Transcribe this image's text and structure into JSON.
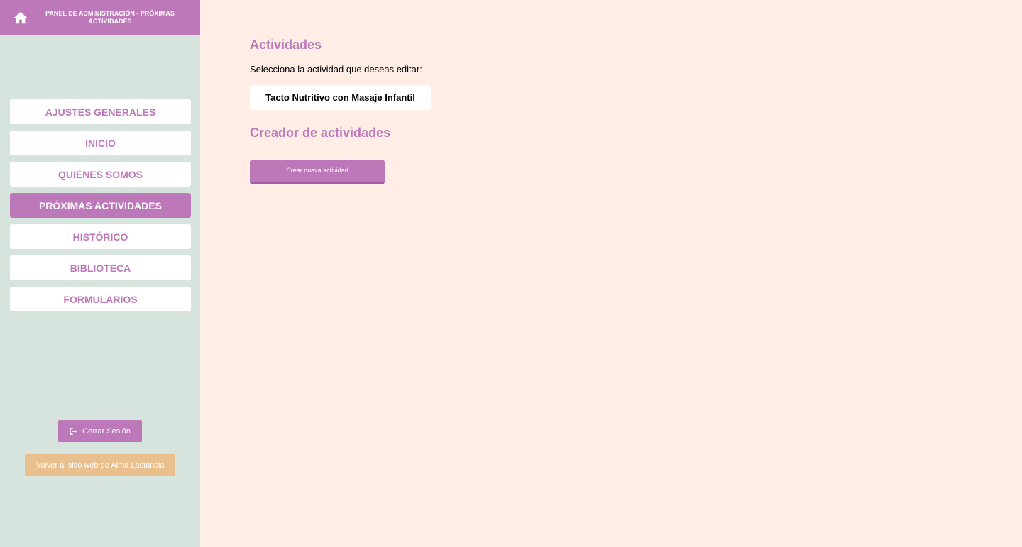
{
  "header": {
    "title": "PANEL DE ADMINISTRACIÓN - PRÓXIMAS ACTIVIDADES",
    "home_icon": "home-icon"
  },
  "sidebar": {
    "items": [
      {
        "label": "AJUSTES GENERALES",
        "active": false
      },
      {
        "label": "INICIO",
        "active": false
      },
      {
        "label": "QUIÉNES SOMOS",
        "active": false
      },
      {
        "label": "PRÓXIMAS ACTIVIDADES",
        "active": true
      },
      {
        "label": "HISTÓRICO",
        "active": false
      },
      {
        "label": "BIBLIOTECA",
        "active": false
      },
      {
        "label": "FORMULARIOS",
        "active": false
      }
    ],
    "logout_label": "Cerrar Sesión",
    "logout_icon": "sign-out-icon",
    "back_label": "Volver al sitio web de Alma Lactancia"
  },
  "main": {
    "activities_title": "Actividades",
    "select_prompt": "Selecciona la actividad que deseas editar:",
    "activities": [
      "Tacto Nutritivo con Masaje Infantil"
    ],
    "creator_title": "Creador de actividades",
    "create_label": "Crear nueva actividad"
  },
  "colors": {
    "accent": "#bd78b9",
    "sidebar_bg": "#d7e3dd",
    "main_bg": "#ffede6",
    "back_button": "#e9bf8e"
  }
}
